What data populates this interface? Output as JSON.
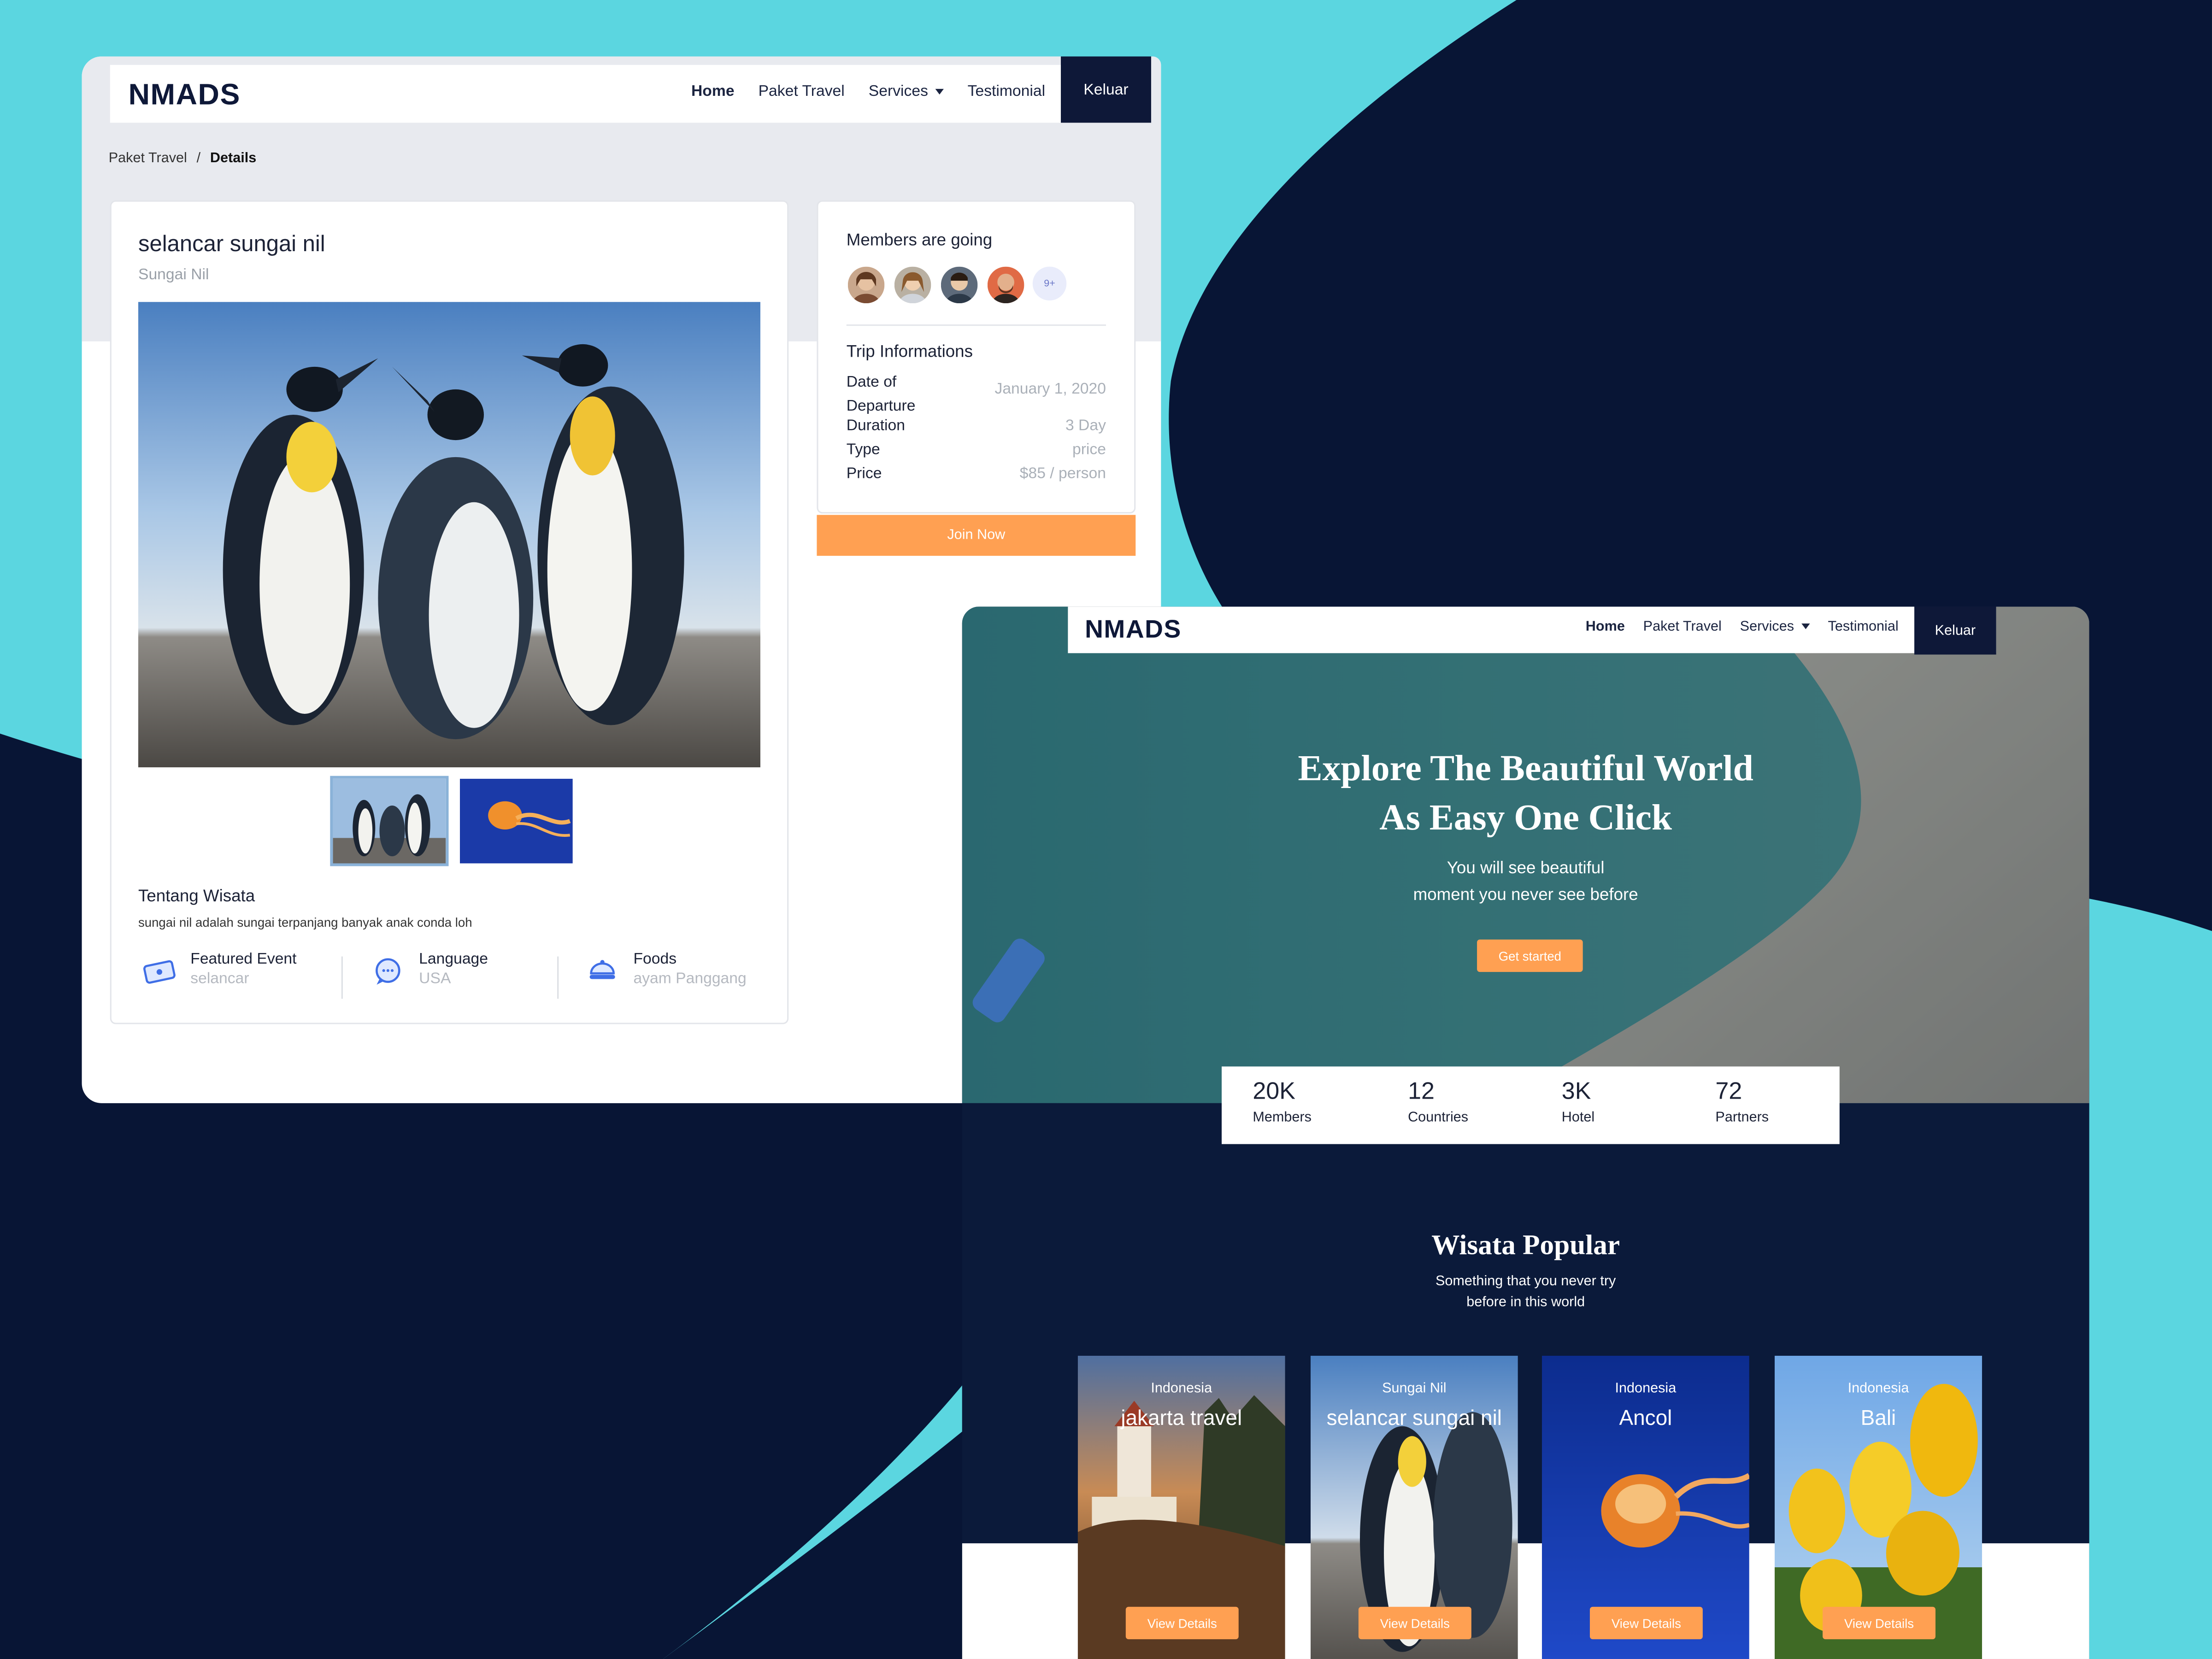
{
  "details_window": {
    "brand": "NMADS",
    "nav": {
      "home": "Home",
      "paket_travel": "Paket Travel",
      "services": "Services",
      "testimonial": "Testimonial",
      "logout": "Keluar"
    },
    "breadcrumb": {
      "parent": "Paket Travel",
      "separator": "/",
      "current": "Details"
    },
    "trip": {
      "title": "selancar sungai nil",
      "location": "Sungai Nil",
      "about_heading": "Tentang Wisata",
      "about_text": "sungai nil adalah sungai terpanjang banyak anak conda loh",
      "features": [
        {
          "label": "Featured Event",
          "value": "selancar",
          "icon": "ticket-icon"
        },
        {
          "label": "Language",
          "value": "USA",
          "icon": "chat-bubble-icon"
        },
        {
          "label": "Foods",
          "value": "ayam Panggang",
          "icon": "food-dish-icon"
        }
      ]
    },
    "sidebar": {
      "members_heading": "Members are going",
      "more_members": "9+",
      "info_heading": "Trip Informations",
      "rows": [
        {
          "label": "Date of Departure",
          "value": "January 1, 2020"
        },
        {
          "label": "Duration",
          "value": "3 Day"
        },
        {
          "label": "Type",
          "value": "price"
        },
        {
          "label": "Price",
          "value": "$85 / person"
        }
      ],
      "join_button": "Join Now"
    }
  },
  "home_window": {
    "brand": "NMADS",
    "nav": {
      "home": "Home",
      "paket_travel": "Paket Travel",
      "services": "Services",
      "testimonial": "Testimonial",
      "logout": "Keluar"
    },
    "hero": {
      "title_line1": "Explore The Beautiful World",
      "title_line2": "As Easy One Click",
      "subtitle_line1": "You will see beautiful",
      "subtitle_line2": "moment you never see before",
      "cta": "Get started"
    },
    "stats": [
      {
        "number": "20K",
        "label": "Members"
      },
      {
        "number": "12",
        "label": "Countries"
      },
      {
        "number": "3K",
        "label": "Hotel"
      },
      {
        "number": "72",
        "label": "Partners"
      }
    ],
    "popular": {
      "heading": "Wisata Popular",
      "sub_line1": "Something that you never try",
      "sub_line2": "before in this world",
      "button": "View Details",
      "cards": [
        {
          "country": "Indonesia",
          "name": "jakarta travel"
        },
        {
          "country": "Sungai Nil",
          "name": "selancar sungai nil"
        },
        {
          "country": "Indonesia",
          "name": "Ancol"
        },
        {
          "country": "Indonesia",
          "name": "Bali"
        }
      ]
    }
  },
  "colors": {
    "navy": "#0e1838",
    "accent_orange": "#ffa052",
    "background_cyan": "#5bd6e0",
    "background_navy": "#081535"
  }
}
